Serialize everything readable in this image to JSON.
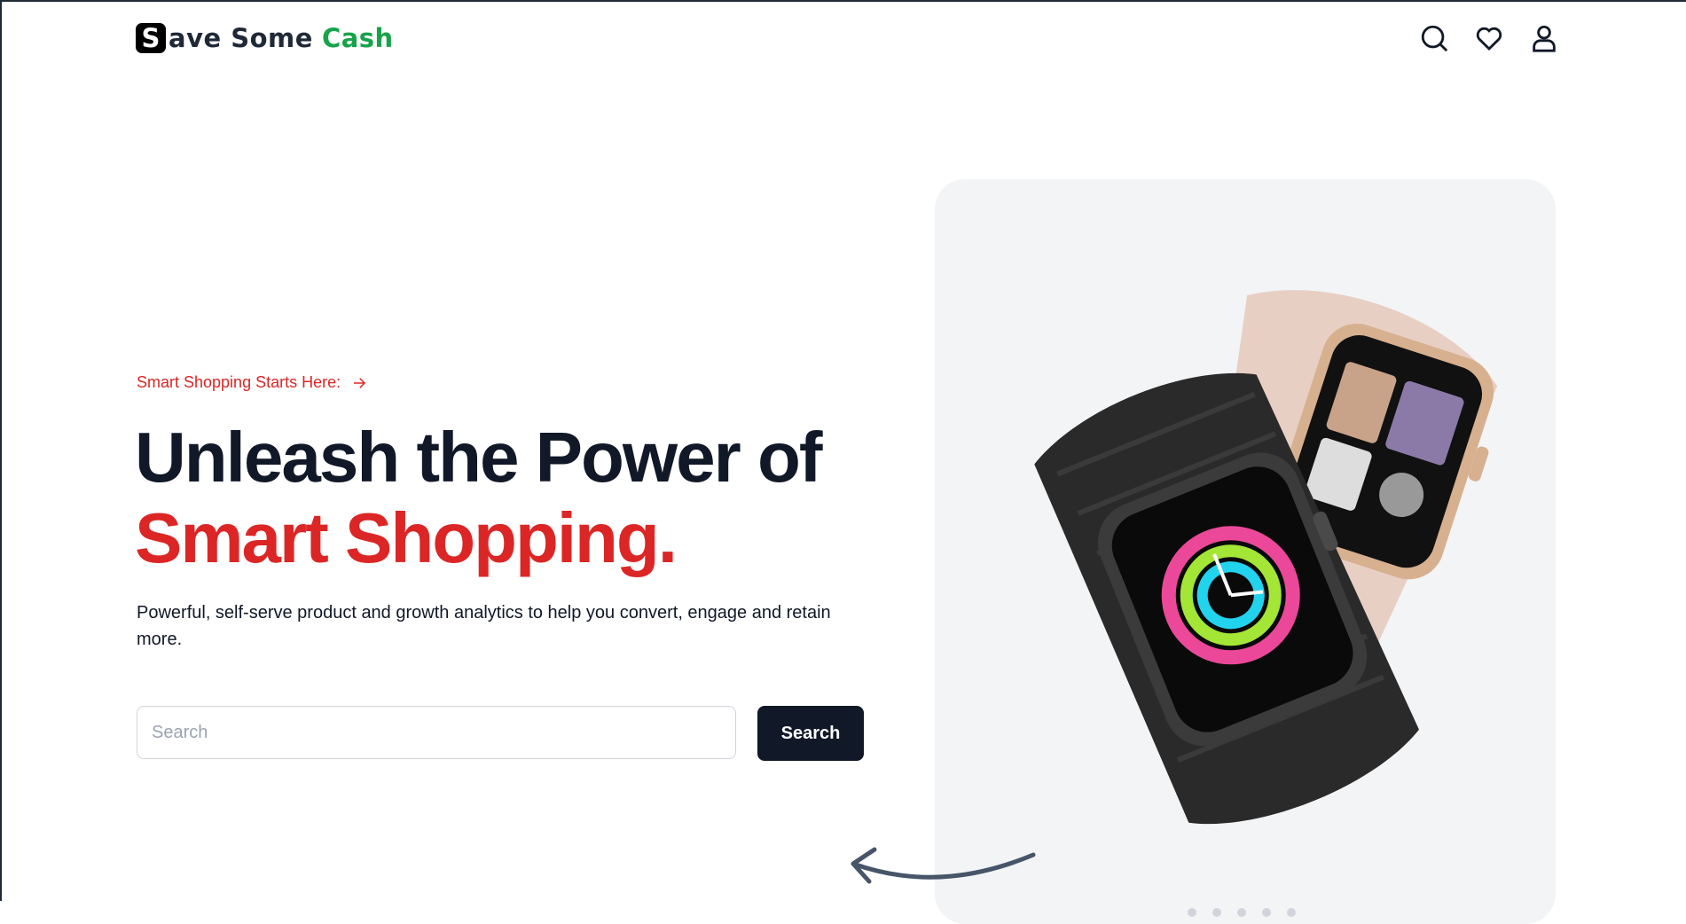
{
  "brand": {
    "mark": "S",
    "name_part": "ave Some",
    "name_accent": "Cash",
    "accent_color": "#16a34a"
  },
  "header": {
    "icons": [
      "search-icon",
      "heart-icon",
      "user-icon"
    ]
  },
  "hero": {
    "eyebrow": "Smart Shopping Starts Here:",
    "headline_line1": "Unleash the Power of",
    "headline_line2": "Smart Shopping.",
    "subtext": "Powerful, self-serve product and growth analytics to help you convert, engage and retain more.",
    "search_placeholder": "Search",
    "search_button": "Search",
    "accent_color": "#dc2626",
    "primary_color": "#111827"
  },
  "product": {
    "image": "smartwatch-image",
    "card_bg": "#f3f4f6"
  }
}
